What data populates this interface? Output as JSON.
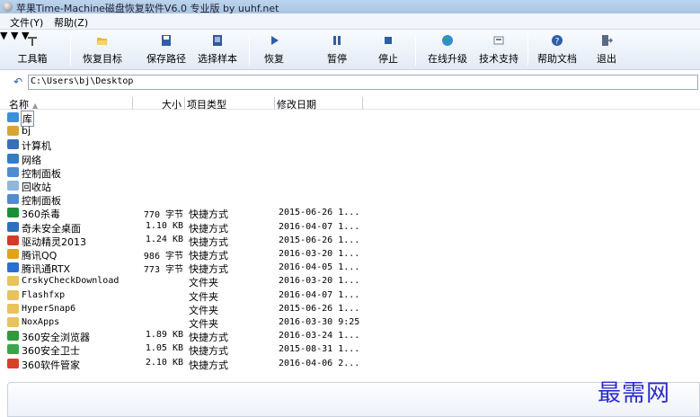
{
  "window": {
    "title": "苹果Time-Machine磁盘恢复软件V6.0 专业版 by uuhf.net"
  },
  "menu": [
    {
      "label": "文件(Y)"
    },
    {
      "label": "帮助(Z)"
    }
  ],
  "toolbar": [
    {
      "label": "工具箱",
      "icon": "toolbox-icon",
      "dropdown": true
    },
    {
      "label": "恢复目标",
      "icon": "folder-open-icon",
      "dropdown": true
    },
    {
      "label": "保存路径",
      "icon": "save-icon"
    },
    {
      "label": "选择样本",
      "icon": "sample-icon"
    },
    {
      "label": "恢复",
      "icon": "play-icon",
      "dropdown": true
    },
    {
      "label": "暂停",
      "icon": "pause-icon"
    },
    {
      "label": "停止",
      "icon": "stop-icon"
    },
    {
      "label": "在线升级",
      "icon": "globe-icon"
    },
    {
      "label": "技术支持",
      "icon": "support-icon"
    },
    {
      "label": "帮助文档",
      "icon": "help-icon"
    },
    {
      "label": "退出",
      "icon": "exit-icon"
    }
  ],
  "path": {
    "value": "C:\\Users\\bj\\Desktop"
  },
  "columns": {
    "name": "名称",
    "size": "大小",
    "type": "项目类型",
    "date": "修改日期"
  },
  "rows": [
    {
      "name": "库",
      "size": "",
      "type": "",
      "date": "",
      "icon": "library-icon",
      "color": "#3b8fd9"
    },
    {
      "name": "bj",
      "size": "",
      "type": "",
      "date": "",
      "icon": "user-folder-icon",
      "color": "#d9a431"
    },
    {
      "name": "计算机",
      "size": "",
      "type": "",
      "date": "",
      "icon": "computer-icon",
      "color": "#3a6fb5"
    },
    {
      "name": "网络",
      "size": "",
      "type": "",
      "date": "",
      "icon": "network-icon",
      "color": "#2f7dc4"
    },
    {
      "name": "控制面板",
      "size": "",
      "type": "",
      "date": "",
      "icon": "control-panel-icon",
      "color": "#4f8cd0"
    },
    {
      "name": "回收站",
      "size": "",
      "type": "",
      "date": "",
      "icon": "recycle-bin-icon",
      "color": "#8fb6dc"
    },
    {
      "name": "控制面板",
      "size": "",
      "type": "",
      "date": "",
      "icon": "control-panel-icon",
      "color": "#4f8cd0"
    },
    {
      "name": "360杀毒",
      "size": "770 字节",
      "type": "快捷方式",
      "date": "2015-06-26 1...",
      "icon": "shortcut-icon",
      "color": "#1c8f3a"
    },
    {
      "name": "奇未安全桌面",
      "size": "1.10 KB",
      "type": "快捷方式",
      "date": "2016-04-07 1...",
      "icon": "shortcut-icon",
      "color": "#2f6fc0"
    },
    {
      "name": "驱动精灵2013",
      "size": "1.24 KB",
      "type": "快捷方式",
      "date": "2015-06-26 1...",
      "icon": "shortcut-icon",
      "color": "#d23a2a"
    },
    {
      "name": "腾讯QQ",
      "size": "986 字节",
      "type": "快捷方式",
      "date": "2016-03-20 1...",
      "icon": "shortcut-icon",
      "color": "#e2a21b"
    },
    {
      "name": "腾讯通RTX",
      "size": "773 字节",
      "type": "快捷方式",
      "date": "2016-04-05 1...",
      "icon": "shortcut-icon",
      "color": "#2a6fd0"
    },
    {
      "name": "CrskyCheckDownload",
      "size": "",
      "type": "文件夹",
      "date": "2016-03-20 1...",
      "icon": "folder-icon",
      "color": "#e8c25a",
      "mono": true
    },
    {
      "name": "Flashfxp",
      "size": "",
      "type": "文件夹",
      "date": "2016-04-07 1...",
      "icon": "folder-icon",
      "color": "#e8c25a",
      "mono": true
    },
    {
      "name": "HyperSnap6",
      "size": "",
      "type": "文件夹",
      "date": "2015-06-26 1...",
      "icon": "folder-icon",
      "color": "#e8c25a",
      "mono": true
    },
    {
      "name": "NoxApps",
      "size": "",
      "type": "文件夹",
      "date": "2016-03-30 9:25",
      "icon": "folder-icon",
      "color": "#e8c25a",
      "mono": true
    },
    {
      "name": "360安全浏览器",
      "size": "1.89 KB",
      "type": "快捷方式",
      "date": "2016-03-24 1...",
      "icon": "shortcut-icon",
      "color": "#2e9a3c"
    },
    {
      "name": "360安全卫士",
      "size": "1.05 KB",
      "type": "快捷方式",
      "date": "2015-08-31 1...",
      "icon": "shortcut-icon",
      "color": "#3aa548"
    },
    {
      "name": "360软件管家",
      "size": "2.10 KB",
      "type": "快捷方式",
      "date": "2016-04-06 2...",
      "icon": "shortcut-icon",
      "color": "#d8402a"
    }
  ],
  "watermark": "最需网"
}
